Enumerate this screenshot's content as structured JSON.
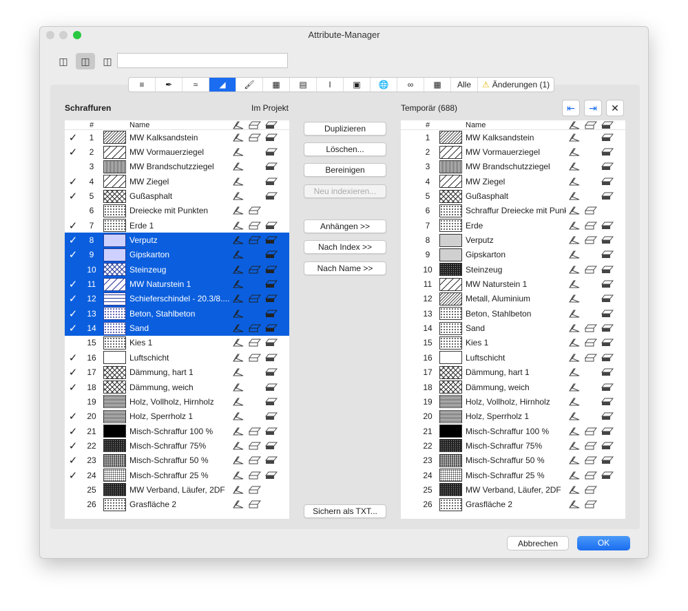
{
  "window": {
    "title": "Attribute-Manager"
  },
  "search": {
    "value": ""
  },
  "tabs": [
    {
      "icon": "layers-icon"
    },
    {
      "icon": "pen-icon"
    },
    {
      "icon": "line-type-icon"
    },
    {
      "icon": "fill-icon",
      "active": true
    },
    {
      "icon": "brush-icon"
    },
    {
      "icon": "composite-icon"
    },
    {
      "icon": "profile-layers-icon"
    },
    {
      "icon": "profile-icon"
    },
    {
      "icon": "zone-icon"
    },
    {
      "icon": "globe-icon"
    },
    {
      "icon": "mep-icon"
    },
    {
      "icon": "grid-icon"
    },
    {
      "label": "Alle"
    },
    {
      "label": "Änderungen (1)",
      "icon": "warning-icon"
    }
  ],
  "left": {
    "title": "Schraffuren",
    "subtitle": "Im Projekt",
    "headers": {
      "num": "#",
      "name": "Name"
    },
    "rows": [
      {
        "n": "1",
        "name": "MW Kalksandstein",
        "chk": true,
        "p": "diag",
        "f": "abc"
      },
      {
        "n": "2",
        "name": "MW Vormauerziegel",
        "chk": true,
        "p": "wide",
        "f": "ac"
      },
      {
        "n": "3",
        "name": "MW Brandschutzziegel",
        "chk": false,
        "p": "dense",
        "f": "ac"
      },
      {
        "n": "4",
        "name": "MW Ziegel",
        "chk": true,
        "p": "wide",
        "f": "ac"
      },
      {
        "n": "5",
        "name": "Gußasphalt",
        "chk": true,
        "p": "cross",
        "f": "ac"
      },
      {
        "n": "6",
        "name": "Dreiecke mit Punkten",
        "chk": false,
        "p": "dots",
        "f": "ab"
      },
      {
        "n": "7",
        "name": "Erde 1",
        "chk": true,
        "p": "dots",
        "f": "abc"
      },
      {
        "n": "8",
        "name": "Verputz",
        "chk": true,
        "p": "fine",
        "f": "abc",
        "sel": true
      },
      {
        "n": "9",
        "name": "Gipskarton",
        "chk": true,
        "p": "fine",
        "f": "ac",
        "sel": true
      },
      {
        "n": "10",
        "name": "Steinzeug",
        "chk": false,
        "p": "cross",
        "f": "abc",
        "sel": true
      },
      {
        "n": "11",
        "name": "MW Naturstein 1",
        "chk": true,
        "p": "wide",
        "f": "ac",
        "sel": true
      },
      {
        "n": "12",
        "name": "Schieferschindel - 20.3/8....",
        "chk": true,
        "p": "brick",
        "f": "abc",
        "sel": true
      },
      {
        "n": "13",
        "name": "Beton, Stahlbeton",
        "chk": true,
        "p": "dots",
        "f": "ac",
        "sel": true
      },
      {
        "n": "14",
        "name": "Sand",
        "chk": true,
        "p": "dots",
        "f": "abc",
        "sel": true
      },
      {
        "n": "15",
        "name": "Kies 1",
        "chk": false,
        "p": "dots",
        "f": "abc"
      },
      {
        "n": "16",
        "name": "Luftschicht",
        "chk": true,
        "p": "none",
        "f": "abc"
      },
      {
        "n": "17",
        "name": "Dämmung, hart 1",
        "chk": true,
        "p": "cross",
        "f": "ac"
      },
      {
        "n": "18",
        "name": "Dämmung, weich",
        "chk": true,
        "p": "cross",
        "f": "ac"
      },
      {
        "n": "19",
        "name": "Holz, Vollholz, Hirnholz",
        "chk": false,
        "p": "horiz",
        "f": "ac"
      },
      {
        "n": "20",
        "name": "Holz, Sperrholz 1",
        "chk": true,
        "p": "horiz",
        "f": "ac"
      },
      {
        "n": "21",
        "name": "Misch-Schraffur 100 %",
        "chk": true,
        "p": "solid",
        "f": "abc"
      },
      {
        "n": "22",
        "name": "Misch-Schraffur 75%",
        "chk": true,
        "p": "dark",
        "f": "abc"
      },
      {
        "n": "23",
        "name": "Misch-Schraffur 50 %",
        "chk": true,
        "p": "mid",
        "f": "abc"
      },
      {
        "n": "24",
        "name": "Misch-Schraffur 25 %",
        "chk": true,
        "p": "light",
        "f": "abc"
      },
      {
        "n": "25",
        "name": "MW Verband, Läufer, 2DF",
        "chk": false,
        "p": "dark",
        "f": "ab"
      },
      {
        "n": "26",
        "name": "Grasfläche 2",
        "chk": false,
        "p": "dots",
        "f": "ab"
      }
    ]
  },
  "right": {
    "title": "Temporär (688)",
    "headers": {
      "num": "#",
      "name": "Name"
    },
    "rows": [
      {
        "n": "1",
        "name": "MW Kalksandstein",
        "p": "diag",
        "f": "ac"
      },
      {
        "n": "2",
        "name": "MW Vormauerziegel",
        "p": "wide",
        "f": "ac"
      },
      {
        "n": "3",
        "name": "MW Brandschutzziegel",
        "p": "dense",
        "f": "ac"
      },
      {
        "n": "4",
        "name": "MW Ziegel",
        "p": "wide",
        "f": "ac"
      },
      {
        "n": "5",
        "name": "Gußasphalt",
        "p": "cross",
        "f": "ac"
      },
      {
        "n": "6",
        "name": "Schraffur Dreiecke mit Punk...",
        "p": "dots",
        "f": "ab"
      },
      {
        "n": "7",
        "name": "Erde",
        "p": "dots",
        "f": "abc"
      },
      {
        "n": "8",
        "name": "Verputz",
        "p": "fine",
        "f": "abc"
      },
      {
        "n": "9",
        "name": "Gipskarton",
        "p": "fine",
        "f": "ac"
      },
      {
        "n": "10",
        "name": "Steinzeug",
        "p": "dark",
        "f": "abc"
      },
      {
        "n": "11",
        "name": "MW Naturstein 1",
        "p": "wide",
        "f": "ac"
      },
      {
        "n": "12",
        "name": "Metall, Aluminium",
        "p": "diag",
        "f": "ac"
      },
      {
        "n": "13",
        "name": "Beton, Stahlbeton",
        "p": "dots",
        "f": "ac"
      },
      {
        "n": "14",
        "name": "Sand",
        "p": "dots",
        "f": "abc"
      },
      {
        "n": "15",
        "name": "Kies 1",
        "p": "dots",
        "f": "abc"
      },
      {
        "n": "16",
        "name": "Luftschicht",
        "p": "none",
        "f": "abc"
      },
      {
        "n": "17",
        "name": "Dämmung, hart 1",
        "p": "cross",
        "f": "ac"
      },
      {
        "n": "18",
        "name": "Dämmung, weich",
        "p": "cross",
        "f": "ac"
      },
      {
        "n": "19",
        "name": "Holz, Vollholz, Hirnholz",
        "p": "horiz",
        "f": "ac"
      },
      {
        "n": "20",
        "name": "Holz, Sperrholz 1",
        "p": "horiz",
        "f": "ac"
      },
      {
        "n": "21",
        "name": "Misch-Schraffur 100 %",
        "p": "solid",
        "f": "abc"
      },
      {
        "n": "22",
        "name": "Misch-Schraffur 75%",
        "p": "dark",
        "f": "abc"
      },
      {
        "n": "23",
        "name": "Misch-Schraffur 50 %",
        "p": "mid",
        "f": "abc"
      },
      {
        "n": "24",
        "name": "Misch-Schraffur 25 %",
        "p": "light",
        "f": "abc"
      },
      {
        "n": "25",
        "name": "MW Verband, Läufer, 2DF",
        "p": "dark",
        "f": "ab"
      },
      {
        "n": "26",
        "name": "Grasfläche 2",
        "p": "dots",
        "f": "ab"
      }
    ]
  },
  "actions": {
    "duplicate": "Duplizieren",
    "delete": "Löschen...",
    "purge": "Bereinigen",
    "reindex": "Neu indexieren...",
    "append": "Anhängen >>",
    "by_index": "Nach Index >>",
    "by_name": "Nach Name >>",
    "save_txt": "Sichern als TXT..."
  },
  "footer": {
    "cancel": "Abbrechen",
    "ok": "OK"
  },
  "colors": {
    "accent": "#1a6cf0",
    "selection": "#0b5fde"
  }
}
